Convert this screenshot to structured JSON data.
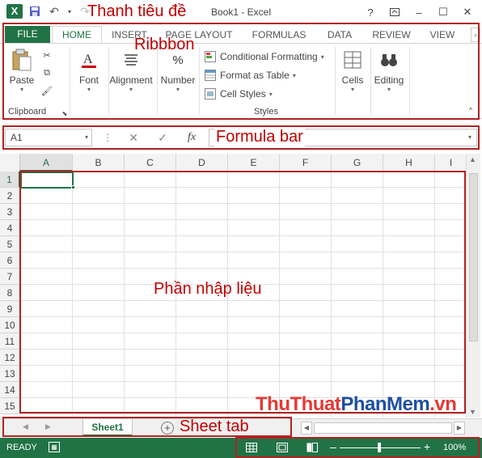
{
  "app": {
    "title": "Book1 - Excel",
    "logo_letter": "X",
    "qat_icons": [
      "save-icon",
      "undo-icon",
      "redo-icon"
    ],
    "window_controls": [
      "?",
      "restore-ribbon",
      "–",
      "☐",
      "✕"
    ]
  },
  "tabs": [
    "FILE",
    "HOME",
    "INSERT",
    "PAGE LAYOUT",
    "FORMULAS",
    "DATA",
    "REVIEW",
    "VIEW"
  ],
  "ribbon": {
    "clipboard": {
      "paste": "Paste",
      "group_label": "Clipboard"
    },
    "font": "Font",
    "alignment": "Alignment",
    "number": "Number",
    "styles": {
      "conditional_formatting": "Conditional Formatting",
      "format_as_table": "Format as Table",
      "cell_styles": "Cell Styles",
      "group_label": "Styles"
    },
    "cells": "Cells",
    "editing": "Editing"
  },
  "formula_bar": {
    "name_box": "A1",
    "fx": "fx",
    "value": ""
  },
  "grid": {
    "columns": [
      "A",
      "B",
      "C",
      "D",
      "E",
      "F",
      "G",
      "H",
      "I"
    ],
    "rows": [
      "1",
      "2",
      "3",
      "4",
      "5",
      "6",
      "7",
      "8",
      "9",
      "10",
      "11",
      "12",
      "13",
      "14",
      "15"
    ],
    "active_cell": "A1"
  },
  "sheets": {
    "tabs": [
      "Sheet1"
    ],
    "active": "Sheet1",
    "add_symbol": "+"
  },
  "status": {
    "mode": "READY",
    "zoom": "100%",
    "zoom_level": 1.0
  },
  "annotations": {
    "title_bar": "Thanh tiêu đề",
    "ribbon": "Ribbbon",
    "formula_bar": "Formula bar",
    "data_entry": "Phần nhập liệu",
    "sheet_tab": "Sheet tab"
  },
  "watermark": {
    "part1": "ThuThuat",
    "part2": "PhanMem",
    "part3": ".vn"
  },
  "colors": {
    "excel_green": "#217346",
    "annotation_red": "#c00000"
  }
}
